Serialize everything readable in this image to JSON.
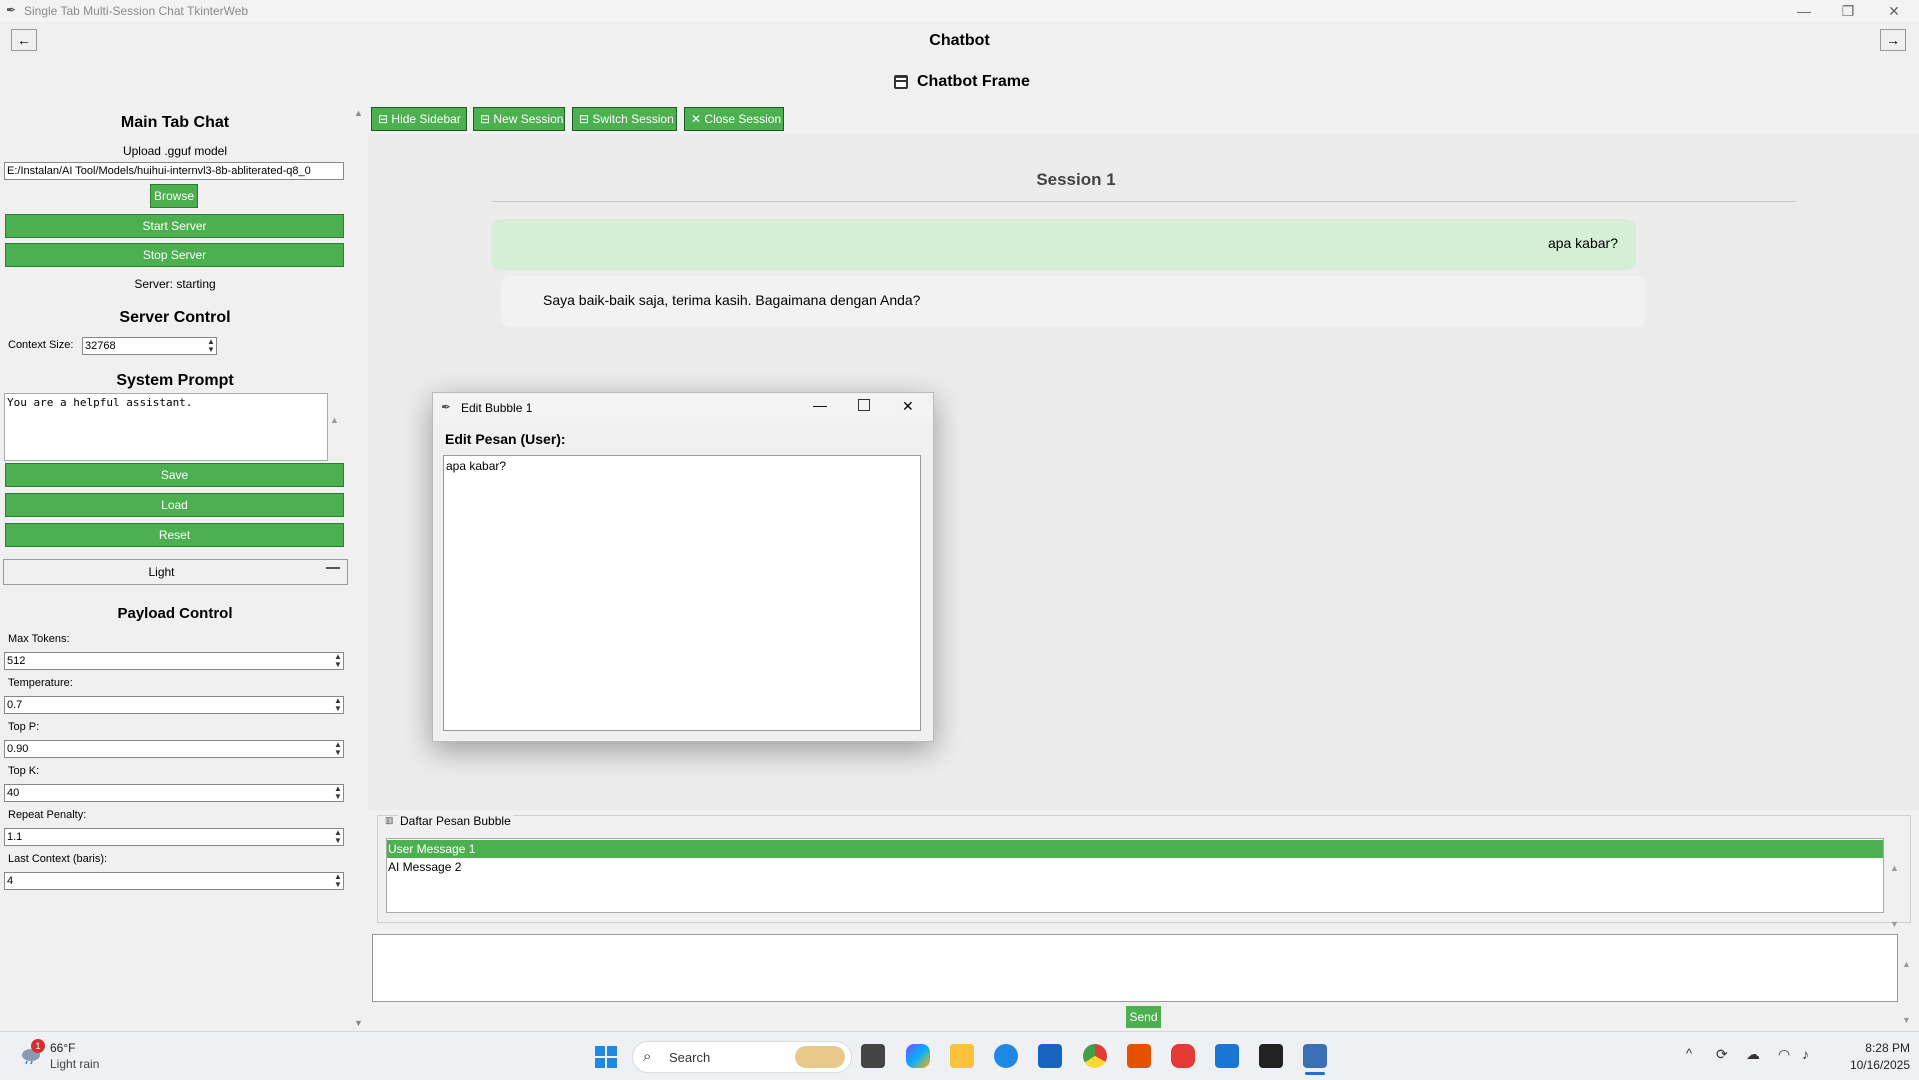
{
  "window": {
    "title": "Single Tab Multi-Session Chat TkinterWeb",
    "minimize_glyph": "—",
    "maximize_glyph": "❐",
    "close_glyph": "✕"
  },
  "header": {
    "title": "Chatbot",
    "back_label": "←",
    "forward_label": "→",
    "frame_title": "Chatbot Frame"
  },
  "sidebar": {
    "main_title": "Main Tab Chat",
    "upload_label": "Upload .gguf model",
    "model_path": "E:/Instalan/AI Tool/Models/huihui-internvl3-8b-abliterated-q8_0",
    "browse_label": "Browse",
    "start_server_label": "Start Server",
    "stop_server_label": "Stop Server",
    "server_status": "Server: starting",
    "server_control_title": "Server Control",
    "context_size_label": "Context Size:",
    "context_size_value": "32768",
    "system_prompt_title": "System Prompt",
    "system_prompt_text": "You are a helpful assistant.",
    "save_label": "Save",
    "load_label": "Load",
    "reset_label": "Reset",
    "theme_value": "Light",
    "payload_title": "Payload Control",
    "params": [
      {
        "label": "Max Tokens:",
        "value": "512"
      },
      {
        "label": "Temperature:",
        "value": "0.7"
      },
      {
        "label": "Top P:",
        "value": "0.90"
      },
      {
        "label": "Top K:",
        "value": "40"
      },
      {
        "label": "Repeat Penalty:",
        "value": "1.1"
      },
      {
        "label": "Last Context (baris):",
        "value": "4"
      }
    ]
  },
  "toolbar": {
    "hide_sidebar": "Hide Sidebar",
    "new_session": "New Session",
    "switch_session": "Switch Session",
    "close_session": "Close Session"
  },
  "chat": {
    "session_title": "Session 1",
    "user_message": "apa kabar?",
    "ai_message": "Saya baik-baik saja, terima kasih. Bagaimana dengan Anda?"
  },
  "dialog": {
    "title": "Edit Bubble 1",
    "heading": "Edit Pesan (User):",
    "text": "apa kabar?"
  },
  "bubble_list": {
    "title": "Daftar Pesan Bubble",
    "items": [
      "User Message 1",
      "AI Message 2"
    ],
    "selected_index": 0
  },
  "input": {
    "value": "",
    "send_label": "Send"
  },
  "taskbar": {
    "weather_temp": "66°F",
    "weather_desc": "Light rain",
    "weather_badge": "1",
    "search_placeholder": "Search",
    "time": "8:28 PM",
    "date": "10/16/2025"
  },
  "colors": {
    "accent_green": "#4caf50",
    "user_bubble": "#d4efd6",
    "ai_bubble": "#f2f2f2"
  }
}
